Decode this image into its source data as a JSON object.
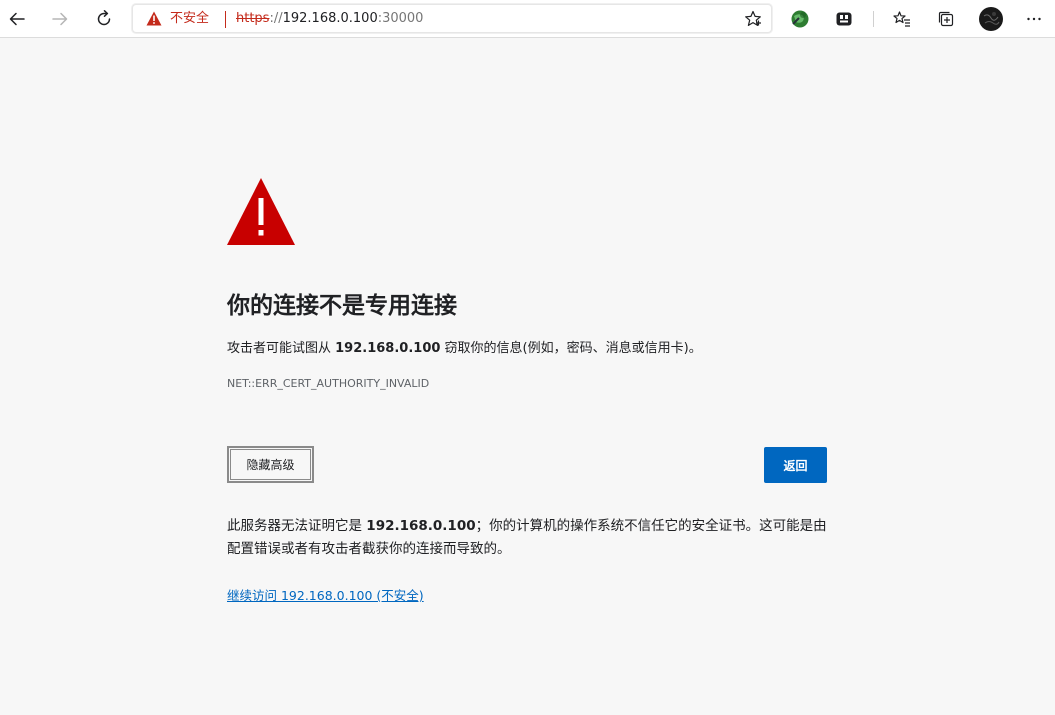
{
  "browser": {
    "address_bar": {
      "security_label": "不安全",
      "url_scheme": "https",
      "url_separator": "://",
      "url_host": "192.168.0.100",
      "url_port": ":30000"
    },
    "icons": {
      "back": "back-arrow-icon",
      "forward": "forward-arrow-icon",
      "refresh": "refresh-icon",
      "warning": "warning-triangle-icon",
      "favorite": "star-icon",
      "extension1": "globe-extension-icon",
      "extension2": "gamepad-extension-icon",
      "favorites": "favorites-list-icon",
      "collections": "collections-icon",
      "profile": "profile-avatar-icon",
      "menu": "more-menu-icon"
    }
  },
  "page": {
    "heading": "你的连接不是专用连接",
    "desc_prefix": "攻击者可能试图从 ",
    "desc_host": "192.168.0.100",
    "desc_suffix": " 窃取你的信息(例如，密码、消息或信用卡)。",
    "error_code": "NET::ERR_CERT_AUTHORITY_INVALID",
    "advanced_button": "隐藏高级",
    "back_button": "返回",
    "detail_prefix": "此服务器无法证明它是 ",
    "detail_host": "192.168.0.100",
    "detail_suffix": "；你的计算机的操作系统不信任它的安全证书。这可能是由配置错误或者有攻击者截获你的连接而导致的。",
    "proceed_link": "继续访问 192.168.0.100 (不安全)"
  },
  "colors": {
    "danger": "#c42b1c",
    "warning_icon": "#c80000",
    "accent": "#0067c0",
    "page_bg": "#f7f7f7"
  }
}
